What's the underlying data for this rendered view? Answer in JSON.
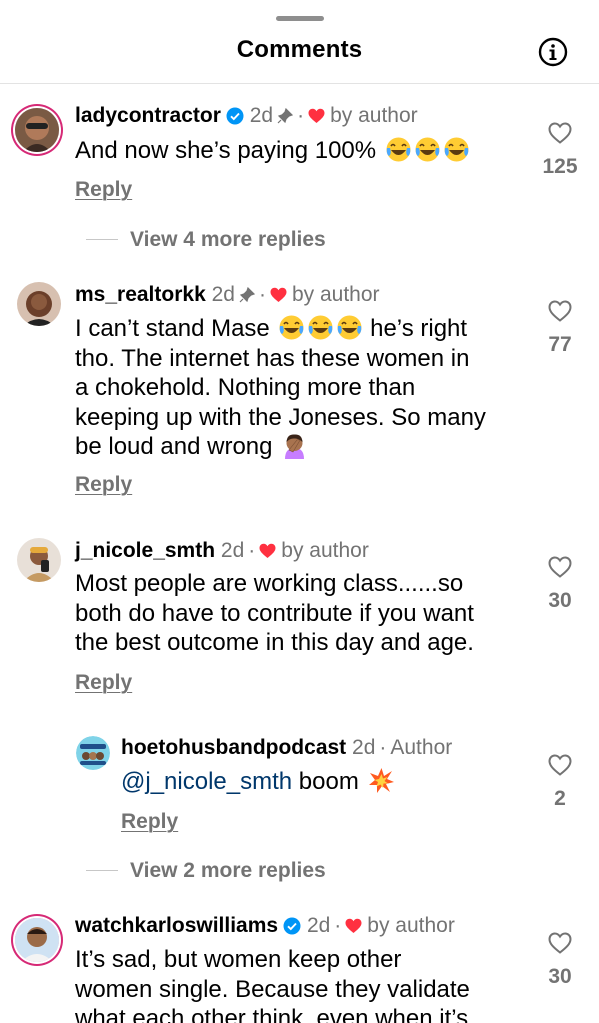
{
  "header": {
    "title": "Comments"
  },
  "comments": [
    {
      "username": "ladycontractor",
      "time": "2d",
      "by_author": "by author",
      "text_before": "And now she’s paying 100%",
      "likes": "125",
      "reply_label": "Reply",
      "view_more": "View 4 more replies"
    },
    {
      "username": "ms_realtorkk",
      "time": "2d",
      "by_author": "by author",
      "line1": "I can’t stand Mase",
      "line1_after": "he’s right",
      "line2": "tho. The internet has these women in",
      "line3": "a chokehold. Nothing more than",
      "line4": "keeping up with the Joneses. So many",
      "line5": "be loud and wrong",
      "likes": "77",
      "reply_label": "Reply"
    },
    {
      "username": "j_nicole_smth",
      "time": "2d",
      "by_author": "by author",
      "line1": "Most people are working class......so",
      "line2": "both do have to contribute if you want",
      "line3": "the best outcome in this day and age.",
      "likes": "30",
      "reply_label": "Reply",
      "view_more": "View 2 more replies"
    },
    {
      "username": "watchkarloswilliams",
      "time": "2d",
      "by_author": "by author",
      "line1": "It’s sad, but women keep other",
      "line2": "women single. Because they validate",
      "line3": "what each other think, even when it’s",
      "likes": "30"
    }
  ],
  "author_reply": {
    "username": "hoetohusbandpodcast",
    "time": "2d",
    "author_label": "Author",
    "mention": "@j_nicole_smth",
    "text": "boom",
    "likes": "2",
    "reply_label": "Reply"
  },
  "colors": {
    "accent_blue": "#0095f6",
    "mention_blue": "#00376b",
    "heart_red": "#ff3040",
    "muted": "#737373"
  },
  "icons": [
    "info-icon",
    "verified-badge-icon",
    "pin-icon",
    "heart-icon",
    "like-heart-icon",
    "tears-of-joy-emoji",
    "facepalm-emoji",
    "collision-emoji"
  ]
}
